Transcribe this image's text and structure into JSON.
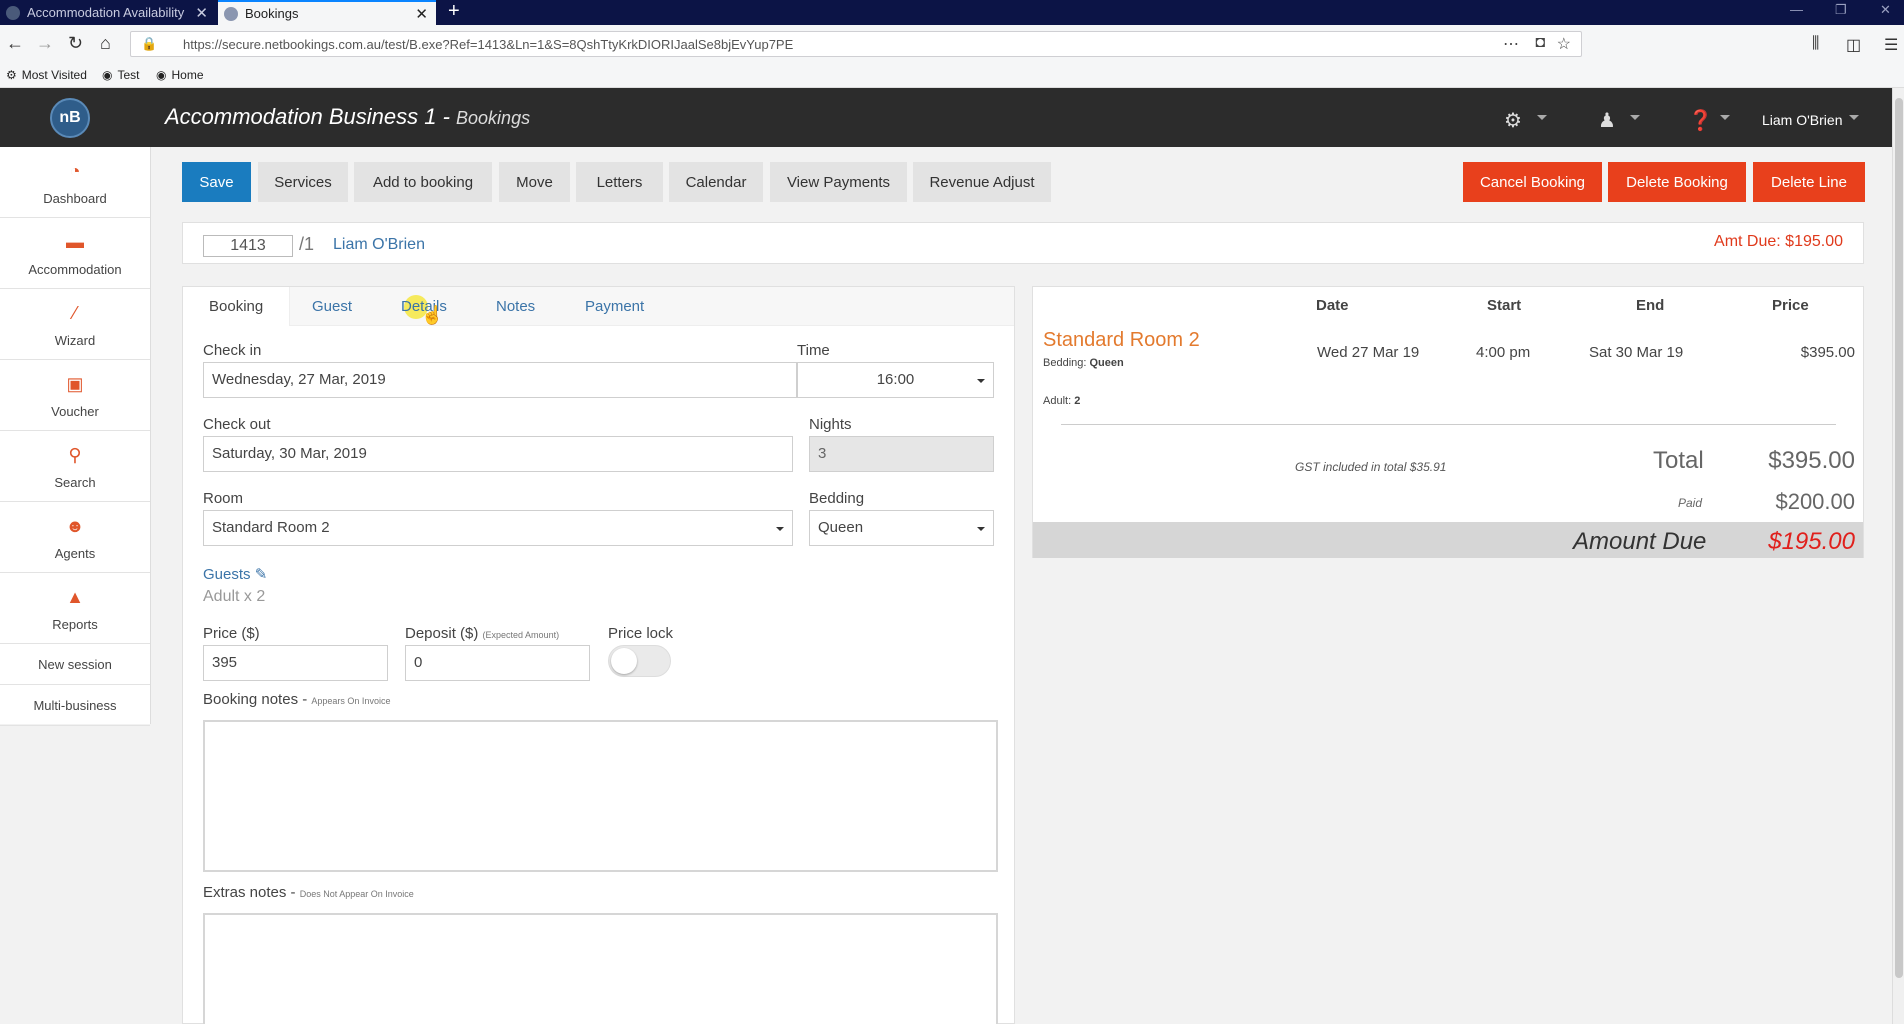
{
  "browser": {
    "tabs": [
      {
        "title": "Accommodation Availability",
        "active": false
      },
      {
        "title": "Bookings",
        "active": true
      }
    ],
    "url": "https://secure.netbookings.com.au/test/B.exe?Ref=1413&Ln=1&S=8QshTtyKrkDIORIJaalSe8bjEvYup7PE",
    "bookmarks": [
      "Most Visited",
      "Test",
      "Home"
    ]
  },
  "header": {
    "logo": "nB",
    "business": "Accommodation Business 1",
    "separator": " - ",
    "section": "Bookings",
    "user": "Liam O'Brien"
  },
  "sidebar": {
    "items": [
      {
        "label": "Dashboard",
        "icon": "dashboard-icon"
      },
      {
        "label": "Accommodation",
        "icon": "bed-icon"
      },
      {
        "label": "Wizard",
        "icon": "wand-icon"
      },
      {
        "label": "Voucher",
        "icon": "gift-icon"
      },
      {
        "label": "Search",
        "icon": "search-icon"
      },
      {
        "label": "Agents",
        "icon": "agent-icon"
      },
      {
        "label": "Reports",
        "icon": "chart-icon"
      }
    ],
    "links": [
      "New session",
      "Multi-business"
    ]
  },
  "toolbar": {
    "save": "Save",
    "services": "Services",
    "add_to_booking": "Add to booking",
    "move": "Move",
    "letters": "Letters",
    "calendar": "Calendar",
    "view_payments": "View Payments",
    "revenue_adjust": "Revenue Adjust",
    "cancel_booking": "Cancel Booking",
    "delete_booking": "Delete Booking",
    "delete_line": "Delete Line"
  },
  "booking": {
    "number": "1413",
    "line": "/1",
    "guest_name": "Liam O'Brien",
    "amt_due": "Amt Due: $195.00"
  },
  "form": {
    "tabs": [
      "Booking",
      "Guest",
      "Details",
      "Notes",
      "Payment"
    ],
    "check_in_label": "Check in",
    "check_in": "Wednesday, 27 Mar, 2019",
    "time_label": "Time",
    "time": "16:00",
    "check_out_label": "Check out",
    "check_out": "Saturday, 30 Mar, 2019",
    "nights_label": "Nights",
    "nights": "3",
    "room_label": "Room",
    "room": "Standard Room 2",
    "bedding_label": "Bedding",
    "bedding": "Queen",
    "guests_label": "Guests",
    "guests": "Adult x 2",
    "price_label": "Price ($)",
    "price": "395",
    "deposit_label": "Deposit ($)",
    "deposit_hint": "(Expected Amount)",
    "deposit": "0",
    "price_lock_label": "Price lock",
    "booking_notes_label": "Booking notes - ",
    "booking_notes_hint": "Appears On Invoice",
    "extras_notes_label": "Extras notes - ",
    "extras_notes_hint": "Does Not Appear On Invoice"
  },
  "summary": {
    "headers": [
      "Date",
      "Start",
      "End",
      "Price"
    ],
    "room": "Standard Room 2",
    "bedding_label": "Bedding:",
    "bedding": "Queen",
    "adult_label": "Adult:",
    "adults": "2",
    "date": "Wed 27 Mar 19",
    "start": "4:00 pm",
    "end": "Sat 30 Mar 19",
    "price": "$395.00",
    "gst": "GST included in total $35.91",
    "total_label": "Total",
    "total": "$395.00",
    "paid_label": "Paid",
    "paid": "$200.00",
    "amount_due_label": "Amount Due",
    "amount_due": "$195.00"
  }
}
